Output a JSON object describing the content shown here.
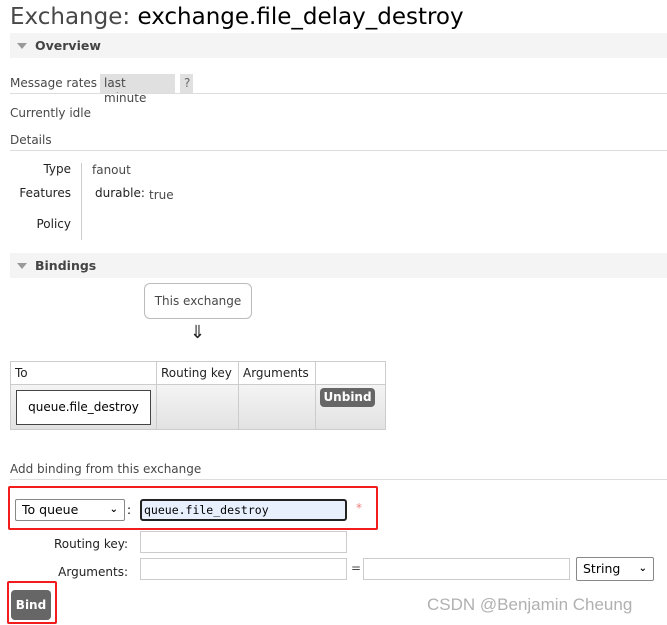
{
  "header": {
    "label": "Exchange:",
    "name": "exchange.file_delay_destroy"
  },
  "overview": {
    "section_title": "Overview",
    "message_rates_label": "Message rates",
    "rate_range": "last minute",
    "help": "?",
    "status": "Currently idle",
    "details_label": "Details",
    "details": {
      "type_label": "Type",
      "type_value": "fanout",
      "features_label": "Features",
      "durable_label": "durable:",
      "durable_value": "true",
      "policy_label": "Policy"
    }
  },
  "bindings": {
    "section_title": "Bindings",
    "source": "This exchange",
    "arrow": "⇓",
    "columns": [
      "To",
      "Routing key",
      "Arguments",
      ""
    ],
    "rows": [
      {
        "to": "queue.file_destroy",
        "routing_key": "",
        "arguments": "",
        "action": "Unbind"
      }
    ]
  },
  "add_binding": {
    "title": "Add binding from this exchange",
    "destination_type": "To queue",
    "colon": ":",
    "destination": "queue.file_destroy",
    "required_mark": "*",
    "routing_key_label": "Routing key:",
    "routing_key_value": "",
    "arguments_label": "Arguments:",
    "equals": "=",
    "argument_type": "String",
    "bind_label": "Bind"
  },
  "watermark": "CSDN @Benjamin Cheung",
  "colors": {
    "highlight": "#f21c1c",
    "button": "#666666",
    "input_focus_bg": "#e8f0fe"
  }
}
